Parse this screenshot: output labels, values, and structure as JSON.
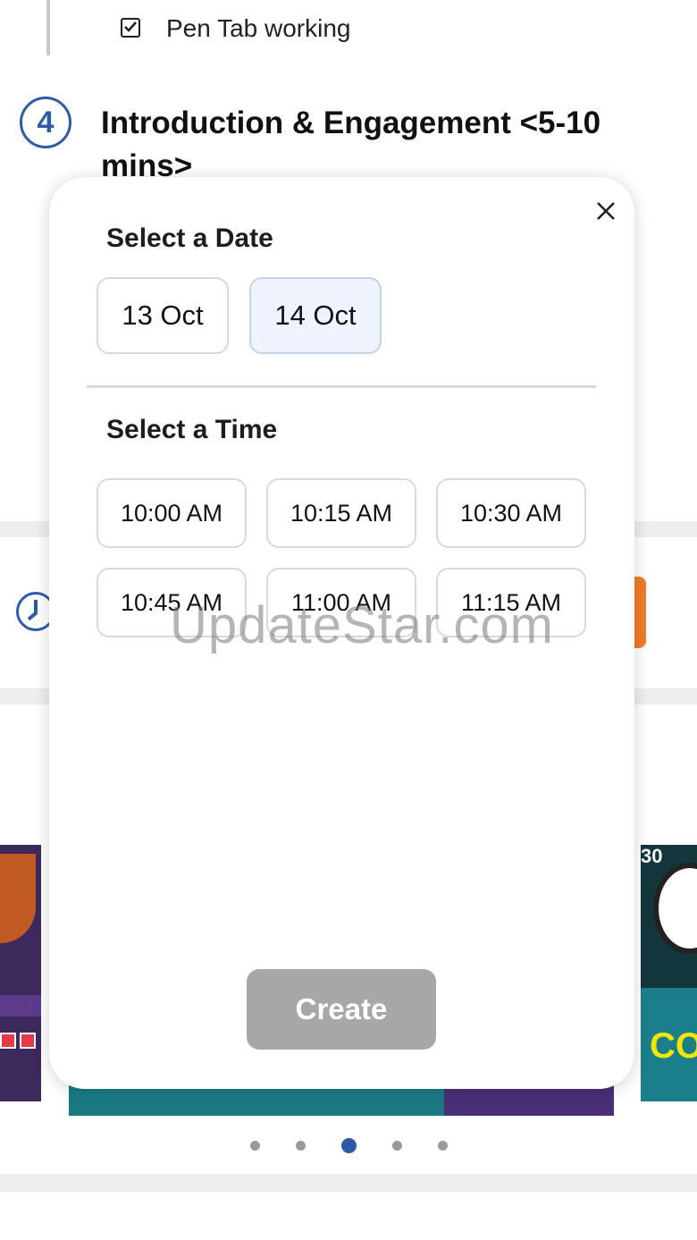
{
  "background": {
    "task_item": {
      "label": "Pen Tab working",
      "checked": true
    },
    "step": {
      "number": "4",
      "title": "Introduction & Engagement <5-10 mins>"
    },
    "carousel": {
      "dots": 5,
      "active_index": 2
    },
    "thumbnail_text": {
      "top_right": "30",
      "yellow": "CO"
    }
  },
  "modal": {
    "date_title": "Select a Date",
    "dates": [
      "13 Oct",
      "14 Oct"
    ],
    "selected_date": "14 Oct",
    "time_title": "Select a Time",
    "times": [
      "10:00 AM",
      "10:15 AM",
      "10:30 AM",
      "10:45 AM",
      "11:00 AM",
      "11:15 AM"
    ],
    "create_label": "Create",
    "create_enabled": false
  },
  "watermark": "UpdateStar.com",
  "colors": {
    "accent": "#2f5aa8",
    "orange": "#f07c2a",
    "disabled": "#a7a7a7",
    "selected_chip": "#eef3fd"
  }
}
